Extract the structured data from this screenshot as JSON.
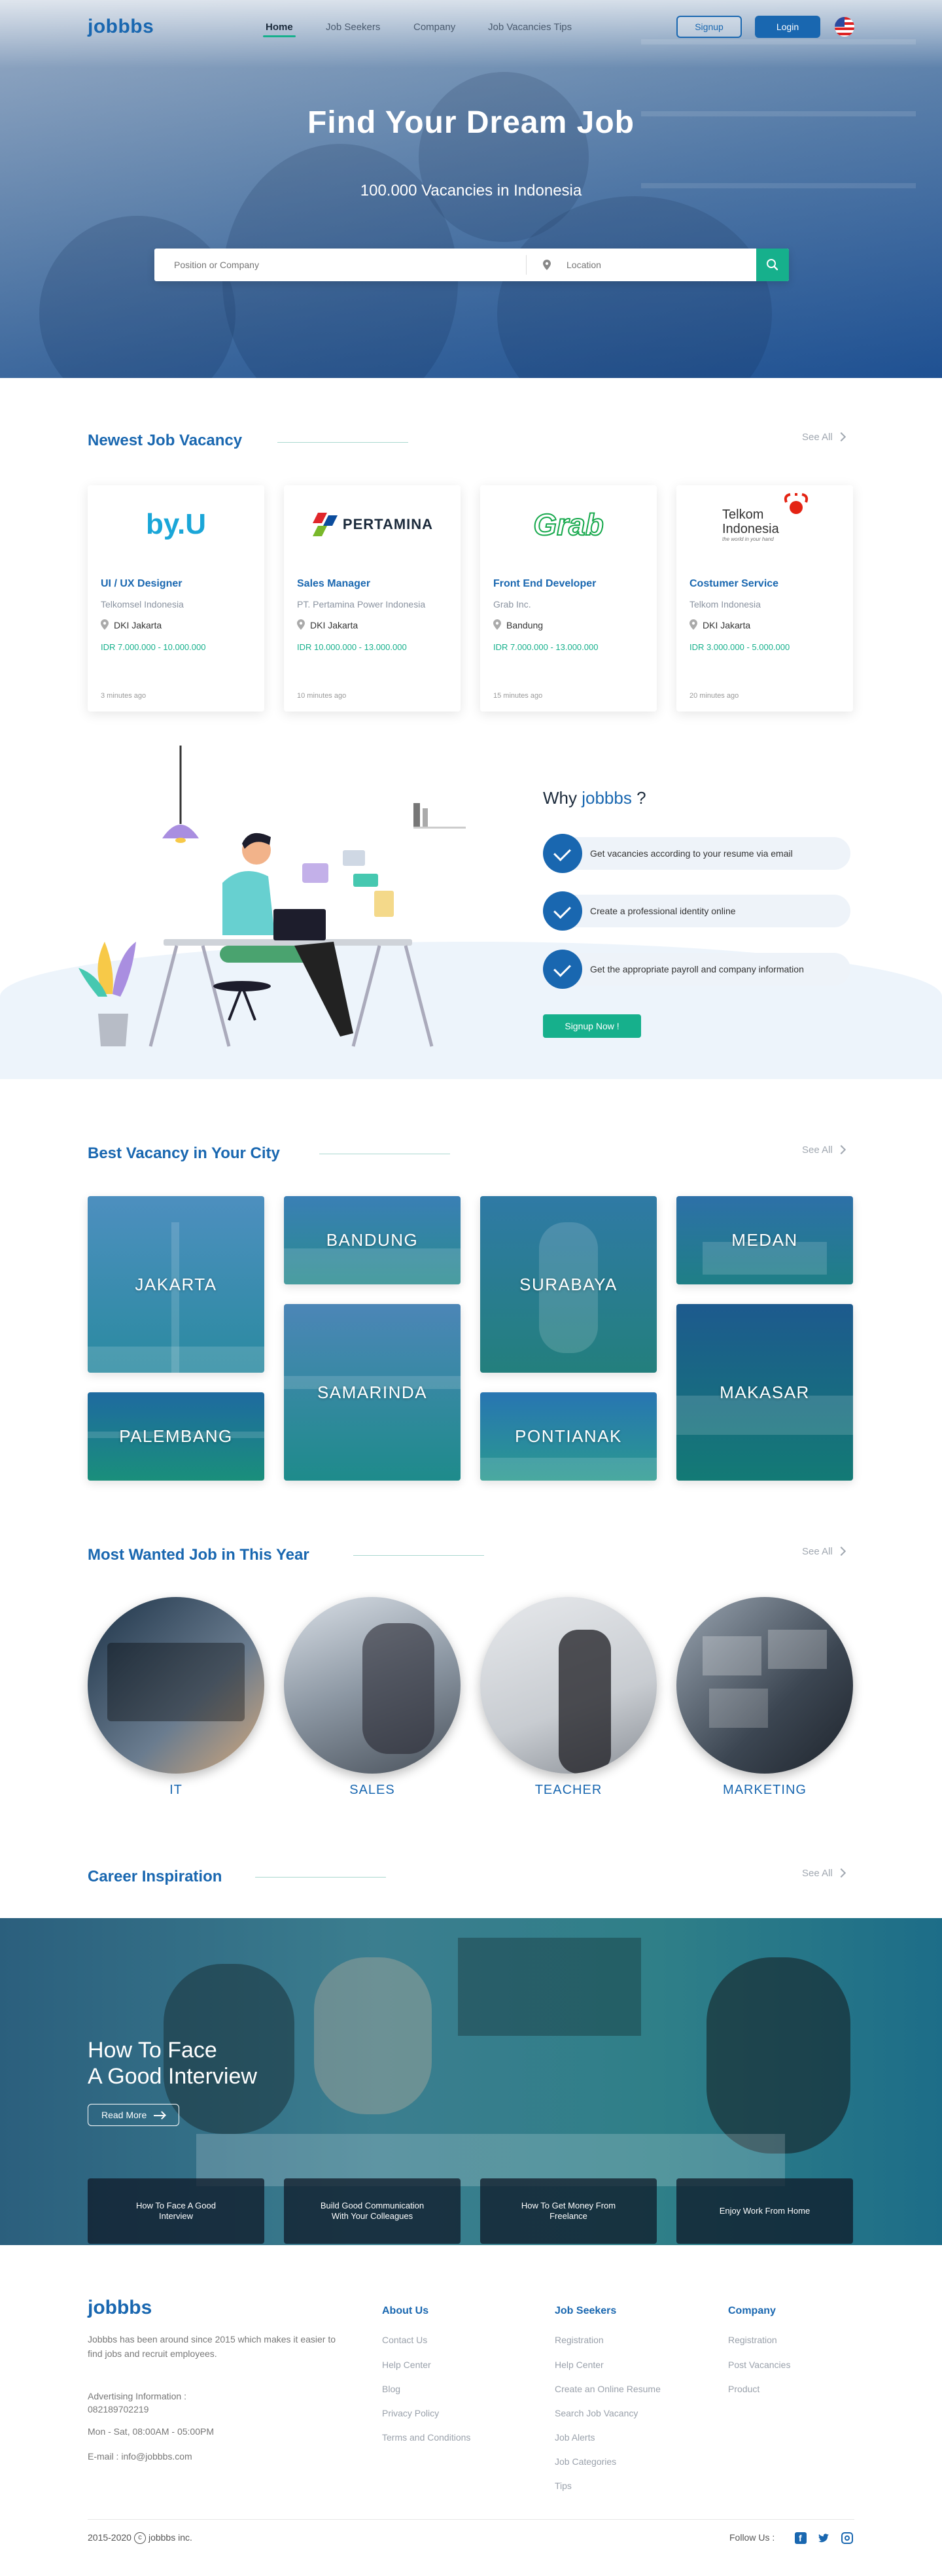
{
  "nav": {
    "logo": "jobbbs",
    "links": [
      "Home",
      "Job Seekers",
      "Company",
      "Job Vacancies Tips"
    ],
    "signup": "Signup",
    "login": "Login",
    "flag_icon": "us-flag-icon"
  },
  "hero": {
    "title": "Find Your Dream Job",
    "subtitle": "100.000 Vacancies in Indonesia",
    "search_placeholder": "Position or Company",
    "location_placeholder": "Location"
  },
  "newest": {
    "title": "Newest Job Vacancy",
    "see_all": "See All",
    "jobs": [
      {
        "logo": "by.U",
        "title": "UI / UX Designer",
        "company": "Telkomsel Indonesia",
        "location": "DKI Jakarta",
        "salary": "IDR 7.000.000 - 10.000.000",
        "time": "3 minutes ago"
      },
      {
        "logo": "PERTAMINA",
        "title": "Sales Manager",
        "company": "PT. Pertamina Power Indonesia",
        "location": "DKI Jakarta",
        "salary": "IDR 10.000.000 - 13.000.000",
        "time": "10 minutes ago"
      },
      {
        "logo": "Grab",
        "title": "Front End Developer",
        "company": "Grab Inc.",
        "location": "Bandung",
        "salary": "IDR 7.000.000 - 13.000.000",
        "time": "15 minutes ago"
      },
      {
        "logo": "Telkom Indonesia",
        "logo_tag": "the world in your hand",
        "title": "Costumer Service",
        "company": "Telkom Indonesia",
        "location": "DKI Jakarta",
        "salary": "IDR 3.000.000 - 5.000.000",
        "time": "20 minutes ago"
      }
    ]
  },
  "why": {
    "title_prefix": "Why",
    "title_brand": "jobbbs",
    "title_suffix": "?",
    "items": [
      "Get vacancies according to your resume via email",
      "Create a professional identity online",
      "Get the appropriate payroll and company information"
    ],
    "cta": "Signup Now !"
  },
  "cities": {
    "title": "Best Vacancy in Your City",
    "see_all": "See All",
    "list": [
      "JAKARTA",
      "BANDUNG",
      "SURABAYA",
      "MEDAN",
      "PALEMBANG",
      "SAMARINDA",
      "PONTIANAK",
      "MAKASAR"
    ]
  },
  "wanted": {
    "title": "Most Wanted Job in This Year",
    "see_all": "See All",
    "list": [
      "IT",
      "SALES",
      "TEACHER",
      "MARKETING"
    ]
  },
  "inspiration": {
    "title": "Career Inspiration",
    "see_all": "See All",
    "hero_line1": "How To Face",
    "hero_line2": "A Good Interview",
    "read_more": "Read More",
    "articles": [
      "How To Face A Good Interview",
      "Build Good Communication With Your Colleagues",
      "How To Get Money From Freelance",
      "Enjoy Work From Home"
    ]
  },
  "footer": {
    "logo": "jobbbs",
    "description": "Jobbbs has been around since 2015 which makes it easier to find jobs and recruit employees.",
    "advertising_label": "Advertising Information :",
    "phone": "082189702219",
    "hours": "Mon - Sat, 08:00AM - 05:00PM",
    "email": "E-mail : info@jobbbs.com",
    "columns": [
      {
        "title": "About Us",
        "links": [
          "Contact Us",
          "Help Center",
          "Blog",
          "Privacy Policy",
          "Terms and Conditions"
        ]
      },
      {
        "title": "Job Seekers",
        "links": [
          "Registration",
          "Help Center",
          "Create an Online Resume",
          "Search Job Vacancy",
          "Job Alerts",
          "Job Categories",
          "Tips"
        ]
      },
      {
        "title": "Company",
        "links": [
          "Registration",
          "Post Vacancies",
          "Product"
        ]
      }
    ],
    "copyright_year": "2015-2020",
    "copyright_name": "jobbbs inc.",
    "follow": "Follow Us :",
    "social_icons": [
      "facebook-icon",
      "twitter-icon",
      "instagram-icon"
    ]
  },
  "colors": {
    "brand_blue": "#1967b0",
    "accent_green": "#16b08c"
  }
}
